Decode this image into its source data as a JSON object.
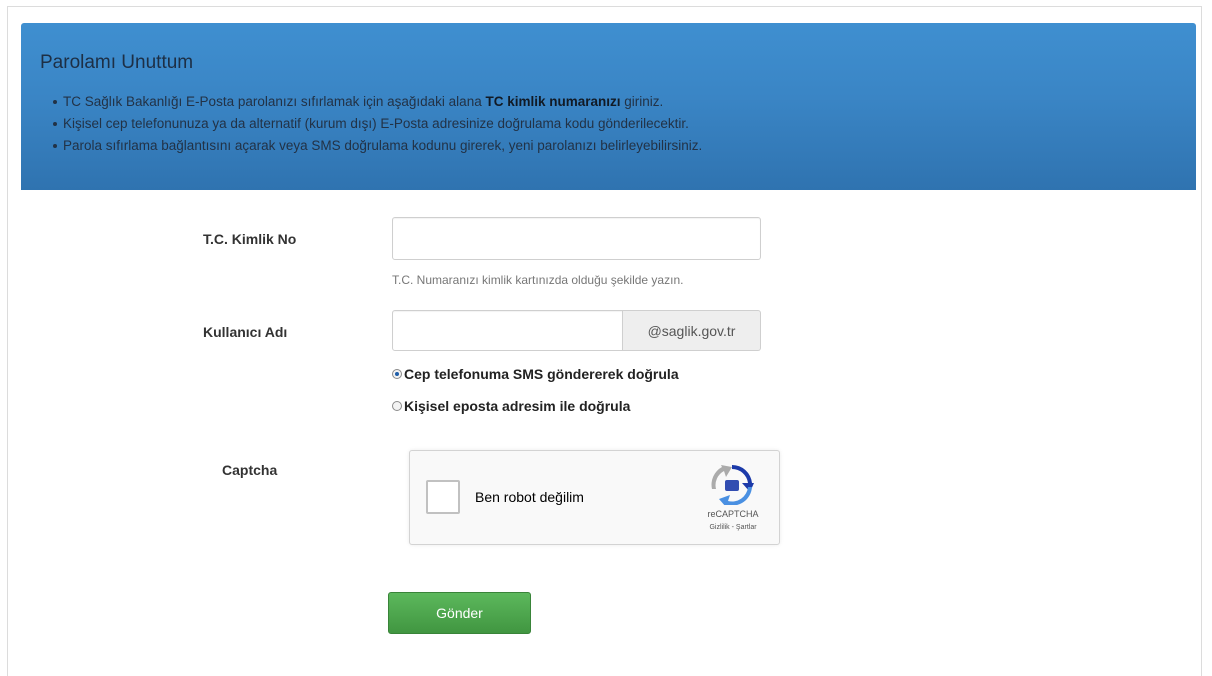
{
  "banner": {
    "title": "Parolamı Unuttum",
    "items": [
      {
        "pre": "TC Sağlık Bakanlığı E-Posta parolanızı sıfırlamak için aşağıdaki alana ",
        "bold": "TC kimlik numaranızı",
        "post": " giriniz."
      },
      {
        "pre": "Kişisel cep telefonunuza ya da alternatif (kurum dışı) E-Posta adresinize doğrulama kodu gönderilecektir.",
        "bold": "",
        "post": ""
      },
      {
        "pre": "Parola sıfırlama bağlantısını açarak veya SMS doğrulama kodunu girerek, yeni parolanızı belirleyebilirsiniz.",
        "bold": "",
        "post": ""
      }
    ]
  },
  "form": {
    "tc_label": "T.C. Kimlik No",
    "tc_value": "",
    "tc_hint": "T.C. Numaranızı kimlik kartınızda olduğu şekilde yazın.",
    "username_label": "Kullanıcı Adı",
    "username_value": "",
    "username_addon": "@saglik.gov.tr",
    "verify_options": [
      {
        "label": "Cep telefonuma SMS göndererek doğrula",
        "checked": true
      },
      {
        "label": "Kişisel eposta adresim ile doğrula",
        "checked": false
      }
    ],
    "captcha_label": "Captcha",
    "submit_label": "Gönder"
  },
  "captcha": {
    "checkbox_text": "Ben robot değilim",
    "brand": "reCAPTCHA",
    "privacy": "Gizlilik",
    "separator": " - ",
    "terms": "Şartlar"
  },
  "colors": {
    "banner": "#3a85c5",
    "submit": "#5cb85c"
  }
}
